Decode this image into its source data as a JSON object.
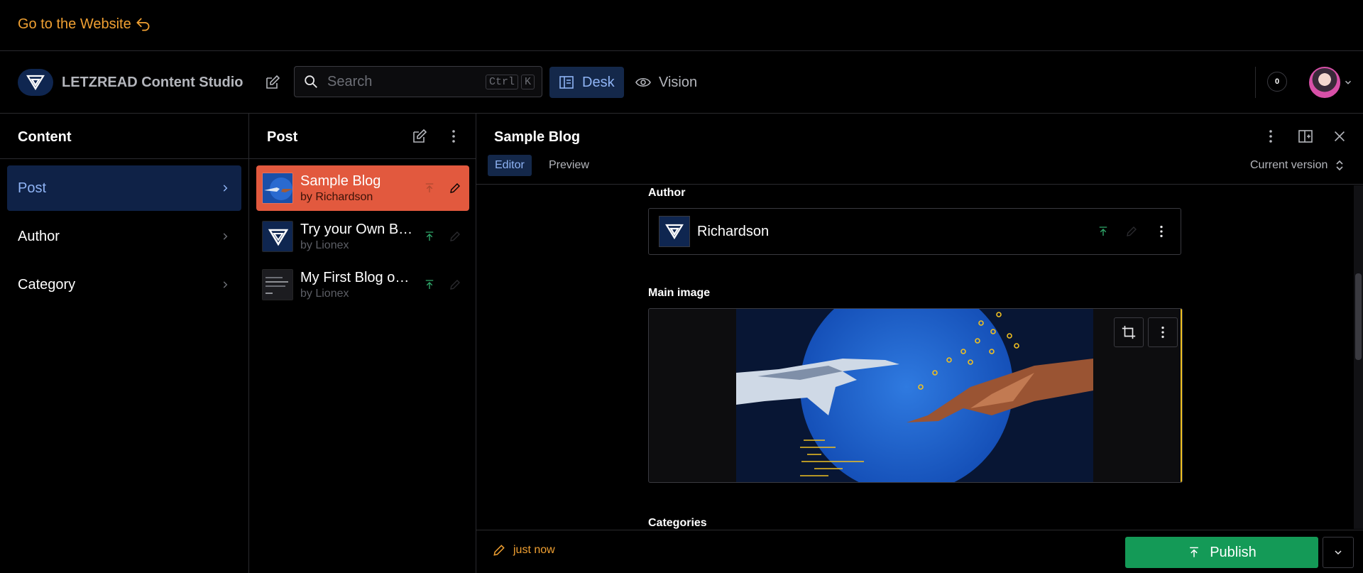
{
  "website_link": {
    "label": "Go to the Website",
    "icon": "return-arrow-icon"
  },
  "navbar": {
    "brand": "LETZREAD Content Studio",
    "search": {
      "placeholder": "Search",
      "shortcut_ctrl": "Ctrl",
      "shortcut_key": "K"
    },
    "tools": [
      {
        "label": "Desk",
        "icon": "desk-icon",
        "active": true
      },
      {
        "label": "Vision",
        "icon": "eye-icon",
        "active": false
      }
    ],
    "notifications_count": "0"
  },
  "content_pane": {
    "title": "Content",
    "items": [
      {
        "label": "Post",
        "active": true
      },
      {
        "label": "Author",
        "active": false
      },
      {
        "label": "Category",
        "active": false
      }
    ]
  },
  "post_pane": {
    "title": "Post",
    "documents": [
      {
        "title": "Sample Blog",
        "subtitle": "by Richardson",
        "active": true
      },
      {
        "title": "Try your Own B…",
        "subtitle": "by Lionex",
        "active": false
      },
      {
        "title": "My First Blog o…",
        "subtitle": "by Lionex",
        "active": false
      }
    ]
  },
  "document": {
    "title": "Sample Blog",
    "tabs": {
      "editor": "Editor",
      "preview": "Preview"
    },
    "version": "Current version",
    "fields": {
      "author_label": "Author",
      "author_value": "Richardson",
      "main_image_label": "Main image",
      "categories_label": "Categories"
    },
    "footer": {
      "saved": "just now",
      "publish": "Publish"
    }
  },
  "colors": {
    "accent_orange": "#f0a032",
    "selected_doc": "#e2593e",
    "publish_green": "#149a57",
    "selected_nav": "#0f2247",
    "focus_yellow": "#f0c020"
  }
}
